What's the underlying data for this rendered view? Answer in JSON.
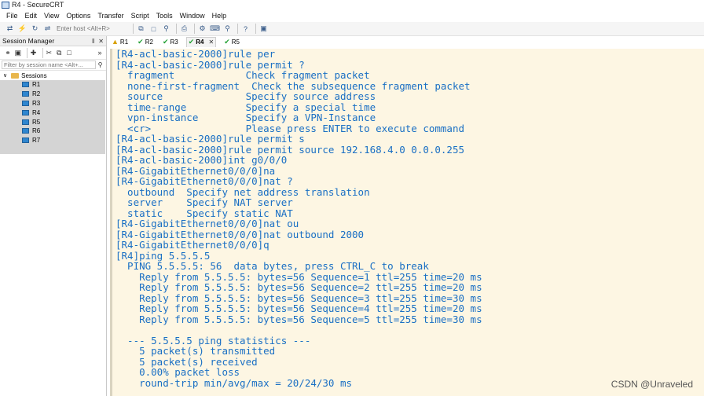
{
  "window": {
    "title": "R4 - SecureCRT"
  },
  "menu": [
    "File",
    "Edit",
    "View",
    "Options",
    "Transfer",
    "Script",
    "Tools",
    "Window",
    "Help"
  ],
  "toolbar": {
    "host_placeholder": "Enter host <Alt+R>"
  },
  "session_manager": {
    "title": "Session Manager",
    "pin": "‖",
    "close": "✕",
    "filter_placeholder": "Filter by session name <Alt+...",
    "root": "Sessions",
    "items": [
      "R1",
      "R2",
      "R3",
      "R4",
      "R5",
      "R6",
      "R7"
    ]
  },
  "tabs": [
    {
      "label": "R1",
      "status": "warn"
    },
    {
      "label": "R2",
      "status": "ok"
    },
    {
      "label": "R3",
      "status": "ok"
    },
    {
      "label": "R4",
      "status": "ok",
      "active": true
    },
    {
      "label": "R5",
      "status": "ok"
    }
  ],
  "terminal": {
    "lines": [
      "[R4-acl-basic-2000]rule per",
      "[R4-acl-basic-2000]rule permit ?",
      "  fragment            Check fragment packet",
      "  none-first-fragment  Check the subsequence fragment packet",
      "  source              Specify source address",
      "  time-range          Specify a special time",
      "  vpn-instance        Specify a VPN-Instance",
      "  <cr>                Please press ENTER to execute command",
      "[R4-acl-basic-2000]rule permit s",
      "[R4-acl-basic-2000]rule permit source 192.168.4.0 0.0.0.255",
      "[R4-acl-basic-2000]int g0/0/0",
      "[R4-GigabitEthernet0/0/0]na",
      "[R4-GigabitEthernet0/0/0]nat ?",
      "  outbound  Specify net address translation",
      "  server    Specify NAT server",
      "  static    Specify static NAT",
      "[R4-GigabitEthernet0/0/0]nat ou",
      "[R4-GigabitEthernet0/0/0]nat outbound 2000",
      "[R4-GigabitEthernet0/0/0]q",
      "[R4]ping 5.5.5.5",
      "  PING 5.5.5.5: 56  data bytes, press CTRL_C to break",
      "    Reply from 5.5.5.5: bytes=56 Sequence=1 ttl=255 time=20 ms",
      "    Reply from 5.5.5.5: bytes=56 Sequence=2 ttl=255 time=20 ms",
      "    Reply from 5.5.5.5: bytes=56 Sequence=3 ttl=255 time=30 ms",
      "    Reply from 5.5.5.5: bytes=56 Sequence=4 ttl=255 time=20 ms",
      "    Reply from 5.5.5.5: bytes=56 Sequence=5 ttl=255 time=30 ms",
      "",
      "  --- 5.5.5.5 ping statistics ---",
      "    5 packet(s) transmitted",
      "    5 packet(s) received",
      "    0.00% packet loss",
      "    round-trip min/avg/max = 20/24/30 ms"
    ]
  },
  "watermark": "CSDN @Unraveled",
  "colors": {
    "terminal_bg": "#fdf6e3",
    "terminal_text": "#1a6fc4",
    "ok": "#22a033",
    "warn": "#d8a000"
  }
}
